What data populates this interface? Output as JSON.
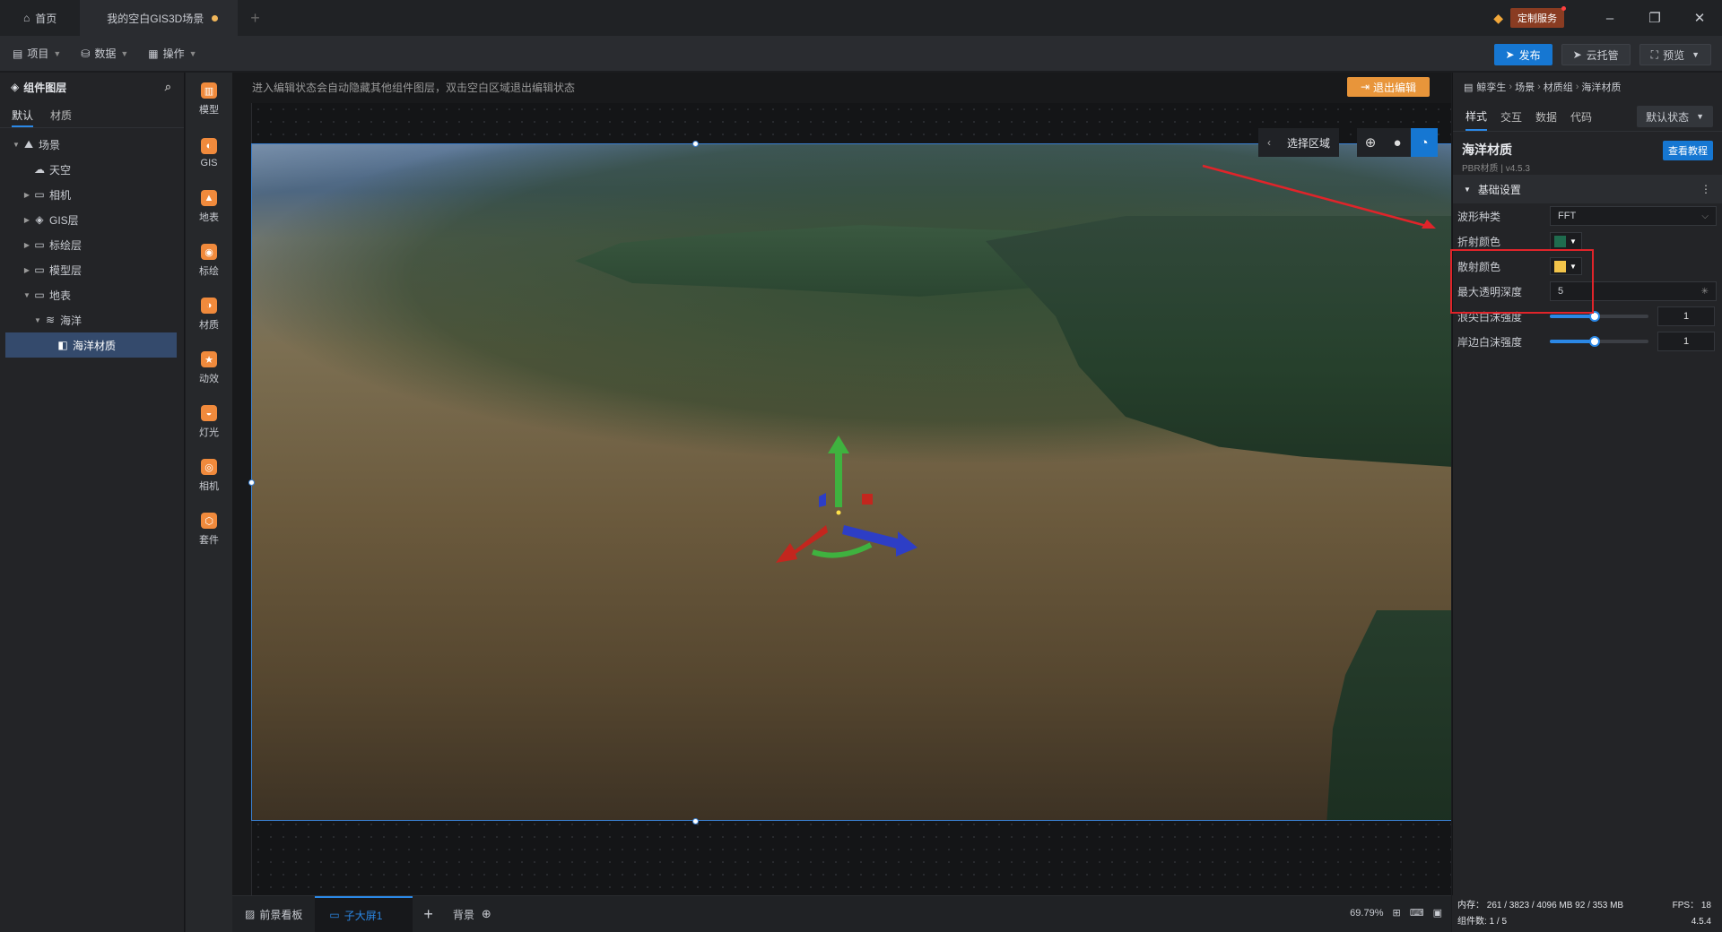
{
  "titlebar": {
    "home_tab": "首页",
    "project_tab": "我的空白GIS3D场景",
    "custom_service": "定制服务"
  },
  "menubar": {
    "items": [
      "项目",
      "数据",
      "操作"
    ],
    "publish": "发布",
    "cloud": "云托管",
    "preview": "预览"
  },
  "left_panel": {
    "title": "组件图层",
    "tabs": [
      "默认",
      "材质"
    ],
    "tree": [
      {
        "label": "场景",
        "icon": "mountain-icon",
        "level": 0,
        "expanded": true
      },
      {
        "label": "天空",
        "icon": "cloud-icon",
        "level": 1
      },
      {
        "label": "相机",
        "icon": "folder-icon",
        "level": 1
      },
      {
        "label": "GIS层",
        "icon": "layers-icon",
        "level": 1
      },
      {
        "label": "标绘层",
        "icon": "folder-icon",
        "level": 1
      },
      {
        "label": "模型层",
        "icon": "folder-icon",
        "level": 1
      },
      {
        "label": "地表",
        "icon": "folder-icon",
        "level": 1,
        "expanded": true
      },
      {
        "label": "海洋",
        "icon": "wave-icon",
        "level": 2,
        "expanded": true
      },
      {
        "label": "海洋材质",
        "icon": "material-icon",
        "level": 3,
        "selected": true
      }
    ]
  },
  "toolcol": [
    {
      "label": "模型",
      "icon": "model-icon"
    },
    {
      "label": "GIS",
      "icon": "globe-icon"
    },
    {
      "label": "地表",
      "icon": "terrain-icon"
    },
    {
      "label": "标绘",
      "icon": "pin-icon"
    },
    {
      "label": "材质",
      "icon": "material-icon"
    },
    {
      "label": "动效",
      "icon": "star-icon"
    },
    {
      "label": "灯光",
      "icon": "light-icon"
    },
    {
      "label": "相机",
      "icon": "camera-icon"
    },
    {
      "label": "套件",
      "icon": "kit-icon"
    }
  ],
  "canvas": {
    "notice": "进入编辑状态会自动隐藏其他组件图层，双击空白区域退出编辑状态",
    "exit_edit": "退出编辑",
    "select_area": "选择区域"
  },
  "bottombar": {
    "tabs": [
      "前景看板",
      "子大屏1"
    ],
    "background": "背景",
    "zoom": "69.79%"
  },
  "right_panel": {
    "breadcrumb": [
      "鲸孪生",
      "场景",
      "材质组",
      "海洋材质"
    ],
    "tabs": [
      "样式",
      "交互",
      "数据",
      "代码"
    ],
    "state": "默认状态",
    "component_name": "海洋材质",
    "component_sub": "PBR材质 | v4.5.3",
    "tutorial": "查看教程",
    "section": "基础设置",
    "wave_type_label": "波形种类",
    "wave_type_value": "FFT",
    "refract_label": "折射颜色",
    "refract_color": "#1f6b4e",
    "scatter_label": "散射颜色",
    "scatter_color": "#f2c44a",
    "max_depth_label": "最大透明深度",
    "max_depth_value": "5",
    "foam_tip_label": "浪尖白沫强度",
    "foam_tip_value": "1",
    "foam_tip_level": 0.45,
    "foam_shore_label": "岸边白沫强度",
    "foam_shore_value": "1",
    "foam_shore_level": 0.45
  },
  "stats": {
    "memory": "内存： 261 / 3823 / 4096 MB  92 / 353 MB",
    "fps": "FPS： 18",
    "components": "组件数: 1 / 5",
    "version": "4.5.4"
  },
  "colors": {
    "accent": "#1677d2",
    "highlight": "#e0242a",
    "exit": "#e8953a"
  }
}
